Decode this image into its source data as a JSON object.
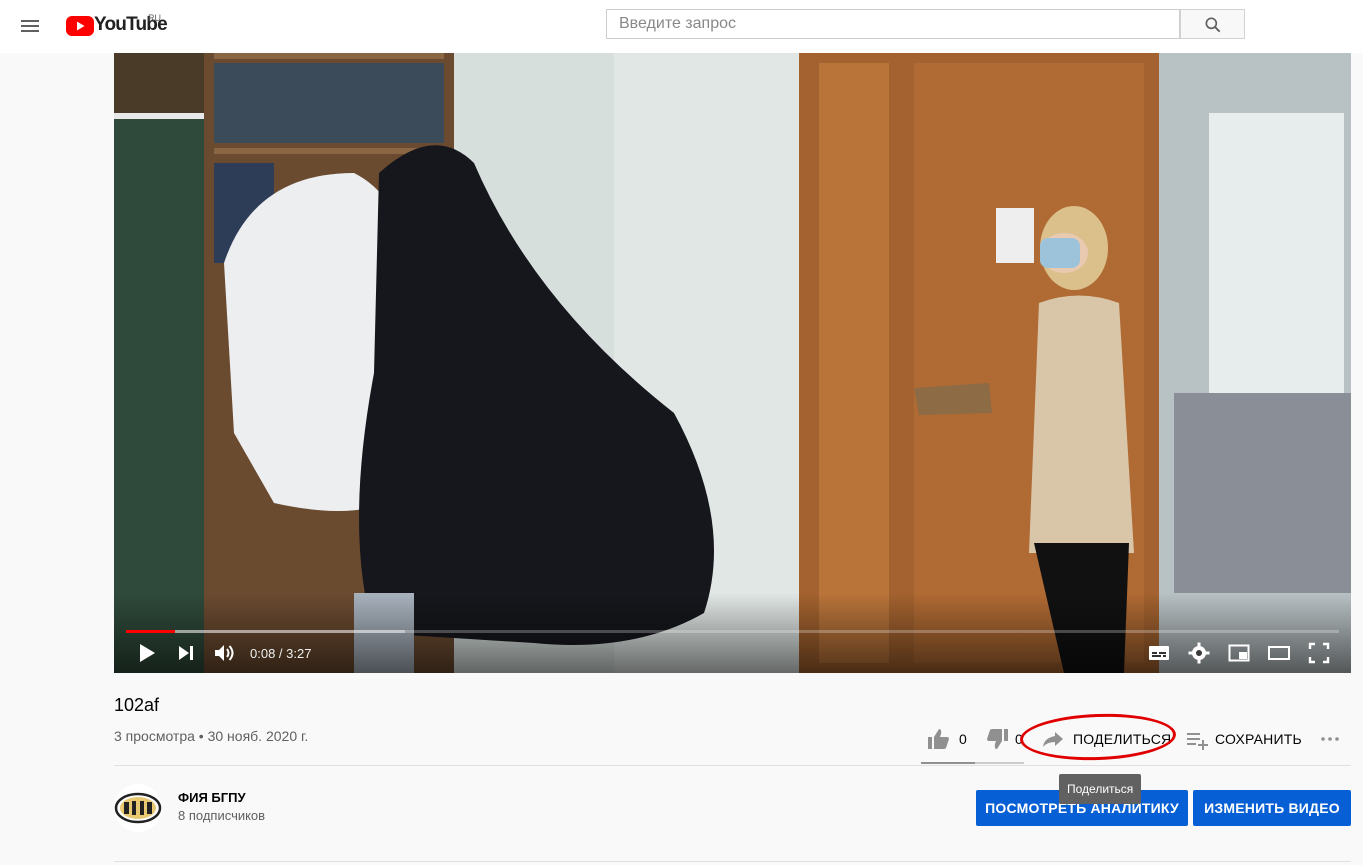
{
  "masthead": {
    "logo_text": "YouTube",
    "region": "RU",
    "search_placeholder": "Введите запрос"
  },
  "player": {
    "time_current": "0:08",
    "time_total": "3:27",
    "time_display": "0:08 / 3:27",
    "progress_fraction": 0.04,
    "buffered_fraction": 0.23
  },
  "video": {
    "title": "102af",
    "meta": "3 просмотра • 30 нояб. 2020 г."
  },
  "actions": {
    "likes": "0",
    "dislikes": "0",
    "share_label": "ПОДЕЛИТЬСЯ",
    "save_label": "СОХРАНИТЬ",
    "share_tooltip": "Поделиться"
  },
  "channel": {
    "name": "ФИЯ БГПУ",
    "subscribers": "8 подписчиков"
  },
  "buttons": {
    "analytics": "ПОСМОТРЕТЬ АНАЛИТИКУ",
    "edit_video": "ИЗМЕНИТЬ ВИДЕО"
  },
  "colors": {
    "brand_red": "#ff0000",
    "action_blue": "#065fd4",
    "annotation_red": "#e00000"
  }
}
